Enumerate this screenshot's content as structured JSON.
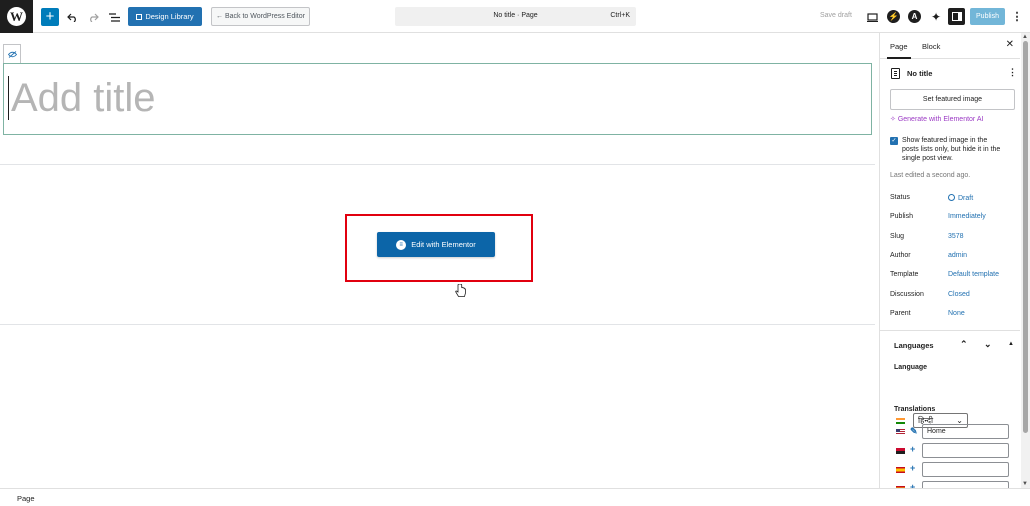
{
  "toolbar": {
    "design_library_label": "Design Library",
    "back_label": "← Back to WordPress Editor",
    "doc_title": "No title · Page",
    "shortcut": "Ctrl+K",
    "save_draft_label": "Save draft",
    "publish_label": "Publish"
  },
  "editor": {
    "title_placeholder": "Add title",
    "elementor_button_label": "Edit with Elementor"
  },
  "sidebar": {
    "tabs": [
      "Page",
      "Block"
    ],
    "doc_title": "No title",
    "featured_image_label": "Set featured image",
    "generate_ai_label": "Generate with Elementor AI",
    "checkbox_label": "Show featured image in the posts lists only, but hide it in the single post view.",
    "last_edited": "Last edited a second ago.",
    "properties": [
      {
        "label": "Status",
        "value": "Draft"
      },
      {
        "label": "Publish",
        "value": "Immediately"
      },
      {
        "label": "Slug",
        "value": "3578"
      },
      {
        "label": "Author",
        "value": "admin"
      },
      {
        "label": "Template",
        "value": "Default template"
      },
      {
        "label": "Discussion",
        "value": "Closed"
      },
      {
        "label": "Parent",
        "value": "None"
      }
    ],
    "languages": {
      "header": "Languages",
      "language_label": "Language",
      "selected_language": "हिन्दी",
      "translations_label": "Translations",
      "translations": [
        {
          "flag": "us",
          "icon": "pencil-icon",
          "value": "Home"
        },
        {
          "flag": "ao",
          "icon": "plus-icon",
          "value": ""
        },
        {
          "flag": "es",
          "icon": "plus-icon",
          "value": ""
        },
        {
          "flag": "es",
          "icon": "plus-icon",
          "value": ""
        }
      ]
    }
  },
  "footer": {
    "breadcrumb": "Page"
  },
  "colors": {
    "accent": "#2271b1",
    "elementor_button": "#0c65a8",
    "highlight": "#e1000f",
    "ai_purple": "#9b3ac4"
  }
}
